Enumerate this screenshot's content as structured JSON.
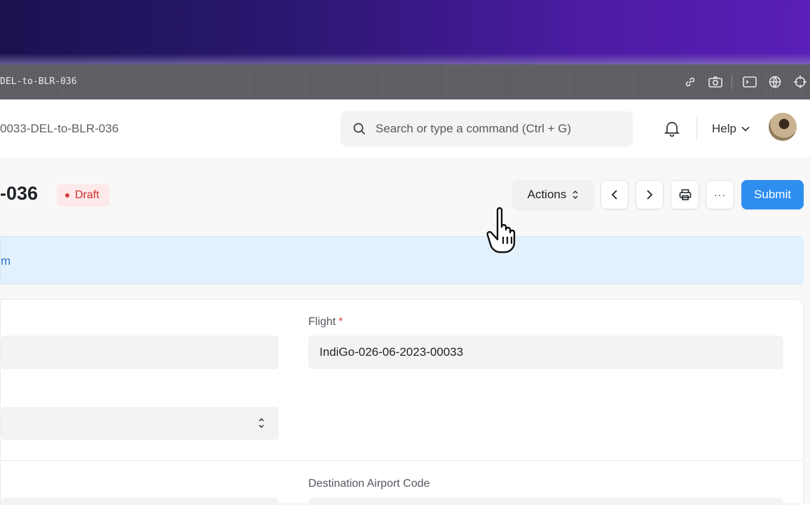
{
  "browser": {
    "url": "DEL-to-BLR-036",
    "icons": [
      "link-icon",
      "camera-icon",
      "terminal-icon",
      "globe-icon",
      "crosshair-icon"
    ]
  },
  "navbar": {
    "breadcrumb": "0033-DEL-to-BLR-036",
    "search_placeholder": "Search or type a command (Ctrl + G)",
    "help_label": "Help"
  },
  "page": {
    "title": "-036",
    "status": "Draft",
    "actions_label": "Actions",
    "submit_label": "Submit",
    "more_label": "···"
  },
  "banner": {
    "text": "m"
  },
  "form": {
    "flight_label": "Flight",
    "flight_required": "*",
    "flight_value": "IndiGo-026-06-2023-00033",
    "destination_label": "Destination Airport Code"
  },
  "colors": {
    "primary": "#2e8ef0",
    "draft_text": "#d12d2d",
    "draft_bg": "#fde9e9",
    "banner_bg": "#e3f1fd"
  }
}
